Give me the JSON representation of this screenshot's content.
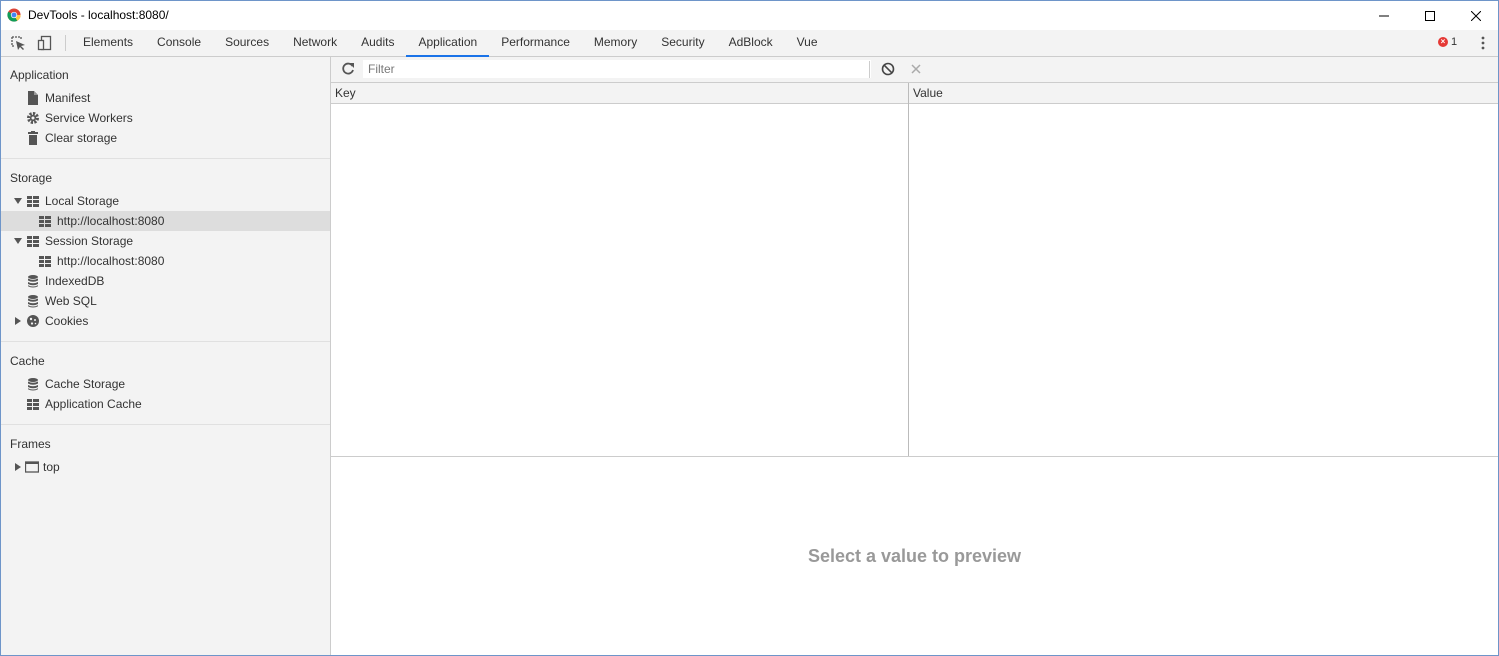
{
  "window": {
    "title": "DevTools - localhost:8080/"
  },
  "tabs": [
    {
      "label": "Elements"
    },
    {
      "label": "Console"
    },
    {
      "label": "Sources"
    },
    {
      "label": "Network"
    },
    {
      "label": "Audits"
    },
    {
      "label": "Application",
      "active": true
    },
    {
      "label": "Performance"
    },
    {
      "label": "Memory"
    },
    {
      "label": "Security"
    },
    {
      "label": "AdBlock"
    },
    {
      "label": "Vue"
    }
  ],
  "errors": {
    "count": "1"
  },
  "sidebar": {
    "application": {
      "title": "Application",
      "items": [
        {
          "label": "Manifest",
          "icon": "document-icon"
        },
        {
          "label": "Service Workers",
          "icon": "gear-icon"
        },
        {
          "label": "Clear storage",
          "icon": "trash-icon"
        }
      ]
    },
    "storage": {
      "title": "Storage",
      "local_storage": {
        "label": "Local Storage",
        "child": "http://localhost:8080"
      },
      "session_storage": {
        "label": "Session Storage",
        "child": "http://localhost:8080"
      },
      "indexeddb": "IndexedDB",
      "websql": "Web SQL",
      "cookies": "Cookies"
    },
    "cache": {
      "title": "Cache",
      "cache_storage": "Cache Storage",
      "application_cache": "Application Cache"
    },
    "frames": {
      "title": "Frames",
      "top": "top"
    }
  },
  "main": {
    "filter_placeholder": "Filter",
    "columns": {
      "key": "Key",
      "value": "Value"
    },
    "preview_message": "Select a value to preview"
  },
  "colors": {
    "accent": "#1a73e8",
    "error": "#e53935",
    "sidebar_bg": "#f3f3f3",
    "selection": "#dddddd"
  }
}
